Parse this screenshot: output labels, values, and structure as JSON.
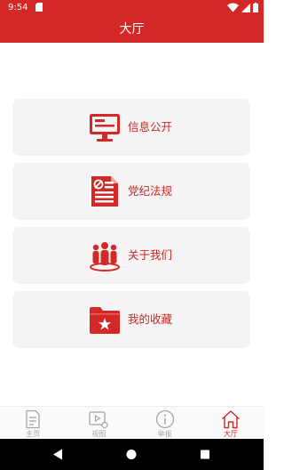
{
  "status_bar": {
    "time": "9:54",
    "left_icon": "sim-card-icon",
    "right_icons": [
      "wifi-icon",
      "signal-icon",
      "battery-icon"
    ]
  },
  "header": {
    "title": "大厅"
  },
  "menu": {
    "items": [
      {
        "label": "信息公开",
        "icon": "monitor-icon"
      },
      {
        "label": "党纪法规",
        "icon": "party-document-icon"
      },
      {
        "label": "关于我们",
        "icon": "people-group-icon"
      },
      {
        "label": "我的收藏",
        "icon": "star-folder-icon"
      }
    ]
  },
  "bottom_nav": {
    "tabs": [
      {
        "label": "主页",
        "icon": "document-page-icon",
        "active": false
      },
      {
        "label": "视图",
        "icon": "video-play-icon",
        "active": false
      },
      {
        "label": "举报",
        "icon": "info-circle-icon",
        "active": false
      },
      {
        "label": "大厅",
        "icon": "home-icon",
        "active": true
      }
    ]
  },
  "system_nav": {
    "buttons": [
      "back-icon",
      "home-circle-icon",
      "recents-icon"
    ]
  },
  "colors": {
    "brand_red": "#d32826",
    "card_bg": "#f5f3f3",
    "inactive_gray": "#a5a5a5"
  }
}
